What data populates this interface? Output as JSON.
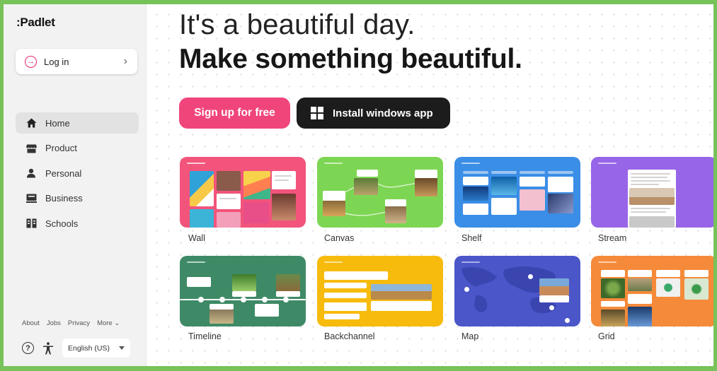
{
  "brand": {
    "logo": ":Padlet"
  },
  "login": {
    "label": "Log in",
    "chevron": "›"
  },
  "nav": {
    "items": [
      {
        "label": "Home",
        "icon": "home-icon",
        "active": true
      },
      {
        "label": "Product",
        "icon": "product-icon",
        "active": false
      },
      {
        "label": "Personal",
        "icon": "person-icon",
        "active": false
      },
      {
        "label": "Business",
        "icon": "business-icon",
        "active": false
      },
      {
        "label": "Schools",
        "icon": "school-icon",
        "active": false
      }
    ]
  },
  "footer": {
    "about": "About",
    "jobs": "Jobs",
    "privacy": "Privacy",
    "more": "More ⌄",
    "help_glyph": "?",
    "language": "English (US)"
  },
  "hero": {
    "line1": "It's a beautiful day.",
    "line2": "Make something beautiful.",
    "signup": "Sign up for free",
    "install": "Install windows app"
  },
  "formats": [
    {
      "label": "Wall",
      "color": "#f2547c"
    },
    {
      "label": "Canvas",
      "color": "#7dd653"
    },
    {
      "label": "Shelf",
      "color": "#3a8ee6"
    },
    {
      "label": "Stream",
      "color": "#9765e8"
    },
    {
      "label": "Timeline",
      "color": "#3f8a66"
    },
    {
      "label": "Backchannel",
      "color": "#f7bb0d"
    },
    {
      "label": "Map",
      "color": "#4b56c9"
    },
    {
      "label": "Grid",
      "color": "#f48a3a"
    }
  ],
  "colors": {
    "accent": "#f0457b",
    "border": "#78c25a"
  }
}
